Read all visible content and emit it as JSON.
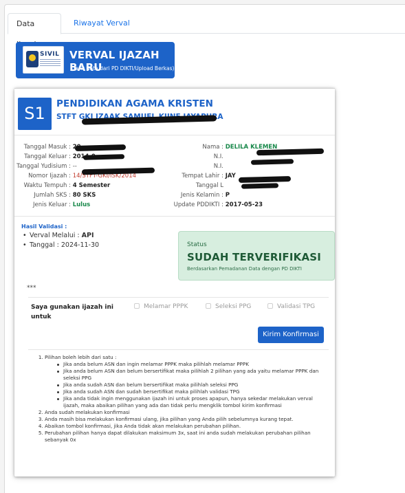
{
  "tabs": [
    {
      "label": "Data Ijazah",
      "active": true
    },
    {
      "label": "Riwayat Verval",
      "active": false
    }
  ],
  "banner": {
    "logo_text": "SIVIL",
    "title": "VERVAL IJAZAH BARU",
    "subtitle": "(Tarik data dari PD DIKTI/Upload Berkas)"
  },
  "card": {
    "jenjang": "S1",
    "prodi": "PENDIDIKAN AGAMA KRISTEN",
    "pt_visible": "STFT GKI IZAAK SAMUEL KIJNE JAYAPURA",
    "left_info": [
      {
        "label": "Tanggal Masuk :",
        "value": "20",
        "style": "bold"
      },
      {
        "label": "Tanggal Keluar :",
        "value": "2014-0",
        "style": "bold"
      },
      {
        "label": "Tanggal Yudisium :",
        "value": "--",
        "style": "normal"
      },
      {
        "label": "Nomor Ijazah :",
        "value": "14/STFT-GKI/ISK/2014",
        "style": "red"
      },
      {
        "label": "Waktu Tempuh :",
        "value": "4 Semester",
        "style": "bold"
      },
      {
        "label": "Jumlah SKS :",
        "value": "80 SKS",
        "style": "bold"
      },
      {
        "label": "Jenis Keluar :",
        "value": "Lulus",
        "style": "green"
      }
    ],
    "right_info": [
      {
        "label": "Nama :",
        "value": "DELILA KLEMEN",
        "style": "green"
      },
      {
        "label": "N.I.",
        "value": "",
        "style": "bold"
      },
      {
        "label": "N.I.",
        "value": "",
        "style": "bold"
      },
      {
        "label": "Tempat Lahir :",
        "value": "JAY",
        "style": "bold"
      },
      {
        "label": "Tanggal L",
        "value": "",
        "style": "bold"
      },
      {
        "label": "Jenis Kelamin :",
        "value": "P",
        "style": "bold"
      },
      {
        "label": "Update PDDIKTI :",
        "value": "2017-05-23",
        "style": "bold"
      }
    ],
    "hasil_validasi": {
      "title": "Hasil Validasi :",
      "verval_label": "Verval Melalui :",
      "verval_value": "API",
      "tanggal_label": "Tanggal :",
      "tanggal_value": "2024-11-30"
    },
    "status": {
      "label": "Status",
      "value": "SUDAH TERVERIFIKASI",
      "description": "Berdasarkan Pemadanan Data dengan PD DIKTI"
    },
    "stars": "***",
    "konfirmasi": {
      "question": "Saya gunakan ijazah ini untuk",
      "options": [
        "Melamar PPPK",
        "Seleksi PPG",
        "Validasi TPG"
      ],
      "button": "Kirim Konfirmasi"
    },
    "notes": {
      "n1": "Pilihan boleh lebih dari satu :",
      "n1_subs": [
        "Jika anda belum ASN dan ingin melamar PPPK maka pilihlah melamar PPPK",
        "Jika anda belum ASN dan belum bersertifikat maka pilihlah 2 pilihan yang ada yaitu melamar PPPK dan seleksi PPG",
        "Jika anda sudah ASN dan belum bersertifikat maka pilihlah seleksi PPG",
        "Jika anda sudah ASN dan sudah bersertifikat maka pilihlah validasi TPG",
        "Jika anda tidak ingin menggunakan ijazah ini untuk proses apapun, hanya sekedar melakukan verval ijazah, maka abaikan pilihan yang ada dan tidak perlu mengklik tombol kirim konfirmasi"
      ],
      "n2": "Anda sudah melakukan konfirmasi",
      "n3": "Anda masih bisa melakukan konfirmasi ulang, jika pilihan yang Anda pilih sebelumnya kurang tepat.",
      "n4": "Abaikan tombol konfirmasi, jika Anda tidak akan melakukan perubahan pilihan.",
      "n5": "Perubahan pilihan hanya dapat dilakukan maksimum 3x, saat ini anda sudah melakukan perubahan pilihan sebanyak 0x"
    }
  },
  "colors": {
    "primary": "#1d63c8",
    "success_bg": "#d7eedf",
    "success_text": "#1e5a36",
    "green_value": "#18884a",
    "red_value": "#c0392b"
  }
}
